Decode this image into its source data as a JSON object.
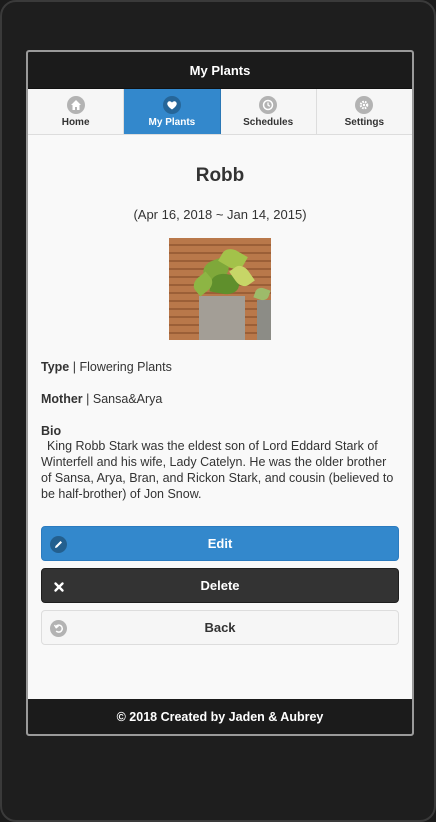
{
  "header": {
    "title": "My Plants"
  },
  "nav": {
    "items": [
      {
        "label": "Home",
        "icon": "home-icon"
      },
      {
        "label": "My Plants",
        "icon": "heart-icon",
        "active": true
      },
      {
        "label": "Schedules",
        "icon": "clock-icon"
      },
      {
        "label": "Settings",
        "icon": "gear-icon"
      }
    ]
  },
  "plant": {
    "name": "Robb",
    "dates": "(Apr 16, 2018 ~ Jan 14, 2015)",
    "type_label": "Type",
    "type_value": "Flowering Plants",
    "mother_label": "Mother",
    "mother_value": "Sansa&Arya",
    "bio_label": "Bio",
    "bio_text": "King Robb Stark was the eldest son of Lord Eddard Stark of Winterfell and his wife, Lady Catelyn. He was the older brother of Sansa, Arya, Bran, and Rickon Stark, and cousin (believed to be half-brother) of Jon Snow."
  },
  "buttons": {
    "edit": "Edit",
    "delete": "Delete",
    "back": "Back"
  },
  "footer": {
    "text": "© 2018 Created by Jaden & Aubrey"
  },
  "colors": {
    "accent": "#3388cc",
    "bar": "#1b1b1b",
    "delete": "#333333"
  }
}
